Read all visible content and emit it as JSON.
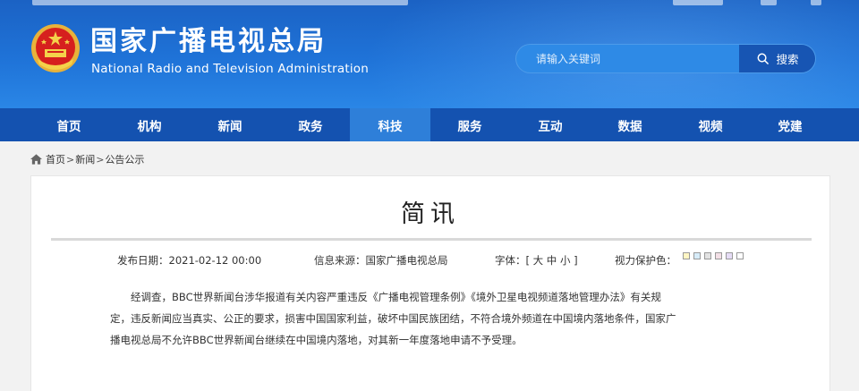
{
  "header": {
    "site_name_cn": "国家广播电视总局",
    "site_name_en": "National Radio and Television Administration",
    "search": {
      "placeholder": "请输入关键词",
      "button_label": "搜索"
    }
  },
  "nav": {
    "items": [
      {
        "label": "首页"
      },
      {
        "label": "机构"
      },
      {
        "label": "新闻"
      },
      {
        "label": "政务"
      },
      {
        "label": "科技",
        "active": true
      },
      {
        "label": "服务"
      },
      {
        "label": "互动"
      },
      {
        "label": "数据"
      },
      {
        "label": "视频"
      },
      {
        "label": "党建"
      }
    ]
  },
  "breadcrumb": {
    "items": [
      "首页",
      "新闻",
      "公告公示"
    ],
    "separator": ">"
  },
  "article": {
    "title": "简讯",
    "publish_label": "发布日期：",
    "publish_date": "2021-02-12 00:00",
    "source_label": "信息来源：",
    "source": "国家广播电视总局",
    "font_label": "字体：",
    "font_options": "[ 大 中 小 ]",
    "eye_care_label": "视力保护色：",
    "eye_care_colors": [
      "#fff6c4",
      "#d7ecf9",
      "#e2e2e2",
      "#f3dfe6",
      "#e6dcf6",
      "#ffffff"
    ],
    "body_lines": [
      "经调查，BBC世界新闻台涉华报道有关内容严重违反《广播电视管理条例》《境外卫星电视频道落地管理办法》有关规",
      "定，违反新闻应当真实、公正的要求，损害中国国家利益，破坏中国民族团结，不符合境外频道在中国境内落地条件，国家广",
      "播电视总局不允许BBC世界新闻台继续在中国境内落地，对其新一年度落地申请不予受理。"
    ]
  },
  "colors": {
    "header_blue": "#1f73d8",
    "nav_blue": "#1452b0",
    "nav_active": "#2e7fd9",
    "search_button": "#1755b3"
  }
}
